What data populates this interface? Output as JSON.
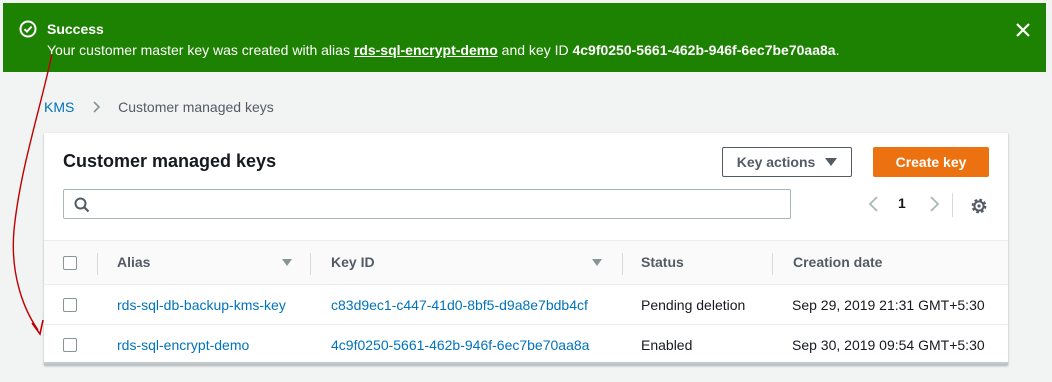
{
  "flash": {
    "title": "Success",
    "message_prefix": "Your customer master key was created with alias ",
    "alias": "rds-sql-encrypt-demo",
    "message_middle": " and key ID ",
    "key_id": "4c9f0250-5661-462b-946f-6ec7be70aa8a",
    "message_suffix": ".",
    "color": "#1d8102",
    "status_icon": "check-circle-icon",
    "close_icon": "close-icon"
  },
  "breadcrumb": {
    "items": [
      "KMS",
      "Customer managed keys"
    ]
  },
  "panel": {
    "title": "Customer managed keys",
    "key_actions_label": "Key actions",
    "create_key_label": "Create key",
    "accent_color": "#ec7211",
    "search_placeholder": "",
    "current_page": "1",
    "search_icon": "search-icon",
    "settings_icon": "gear-icon"
  },
  "table": {
    "columns": [
      "Alias",
      "Key ID",
      "Status",
      "Creation date"
    ],
    "rows": [
      {
        "alias": "rds-sql-db-backup-kms-key",
        "key_id": "c83d9ec1-c447-41d0-8bf5-d9a8e7bdb4cf",
        "status": "Pending deletion",
        "creation_date": "Sep 29, 2019 21:31 GMT+5:30"
      },
      {
        "alias": "rds-sql-encrypt-demo",
        "key_id": "4c9f0250-5661-462b-946f-6ec7be70aa8a",
        "status": "Enabled",
        "creation_date": "Sep 30, 2019 09:54 GMT+5:30"
      }
    ]
  },
  "annotation": {
    "color": "#c00000"
  }
}
